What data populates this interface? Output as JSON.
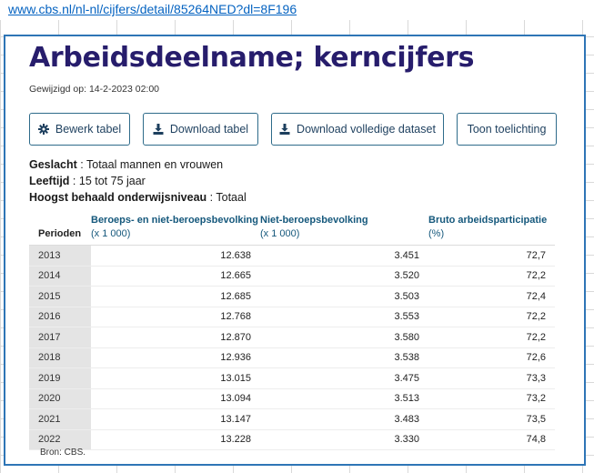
{
  "link": {
    "url": "www.cbs.nl/nl-nl/cijfers/detail/85264NED?dl=8F196"
  },
  "title": "Arbeidsdeelname; kerncijfers",
  "modified": "Gewijzigd op: 14-2-2023 02:00",
  "buttons": {
    "edit": "Bewerk tabel",
    "download": "Download tabel",
    "download_full": "Download volledige dataset",
    "explanation": "Toon toelichting"
  },
  "icons": {
    "edit": "gear-icon",
    "download": "download-icon",
    "download_full": "download-icon"
  },
  "filters": [
    {
      "label": "Geslacht",
      "value": " : Totaal mannen en vrouwen"
    },
    {
      "label": "Leeftijd",
      "value": " : 15 tot 75 jaar"
    },
    {
      "label": "Hoogst behaald onderwijsniveau",
      "value": " : Totaal"
    }
  ],
  "table": {
    "headers": [
      {
        "name": "Perioden",
        "unit": ""
      },
      {
        "name": "Beroeps- en niet-beroepsbevolking",
        "unit": "(x 1 000)"
      },
      {
        "name": "Niet-beroepsbevolking",
        "unit": "(x 1 000)"
      },
      {
        "name": "Bruto arbeidsparticipatie",
        "unit": "(%)"
      }
    ],
    "rows": [
      [
        "2013",
        "12.638",
        "3.451",
        "72,7"
      ],
      [
        "2014",
        "12.665",
        "3.520",
        "72,2"
      ],
      [
        "2015",
        "12.685",
        "3.503",
        "72,4"
      ],
      [
        "2016",
        "12.768",
        "3.553",
        "72,2"
      ],
      [
        "2017",
        "12.870",
        "3.580",
        "72,2"
      ],
      [
        "2018",
        "12.936",
        "3.538",
        "72,6"
      ],
      [
        "2019",
        "13.015",
        "3.475",
        "73,3"
      ],
      [
        "2020",
        "13.094",
        "3.513",
        "73,2"
      ],
      [
        "2021",
        "13.147",
        "3.483",
        "73,5"
      ],
      [
        "2022",
        "13.228",
        "3.330",
        "74,8"
      ]
    ]
  },
  "source": "Bron: CBS.",
  "colors": {
    "title": "#271d6c",
    "header": "#15587c",
    "link": "#0563c1",
    "frame": "#2e75b6"
  }
}
